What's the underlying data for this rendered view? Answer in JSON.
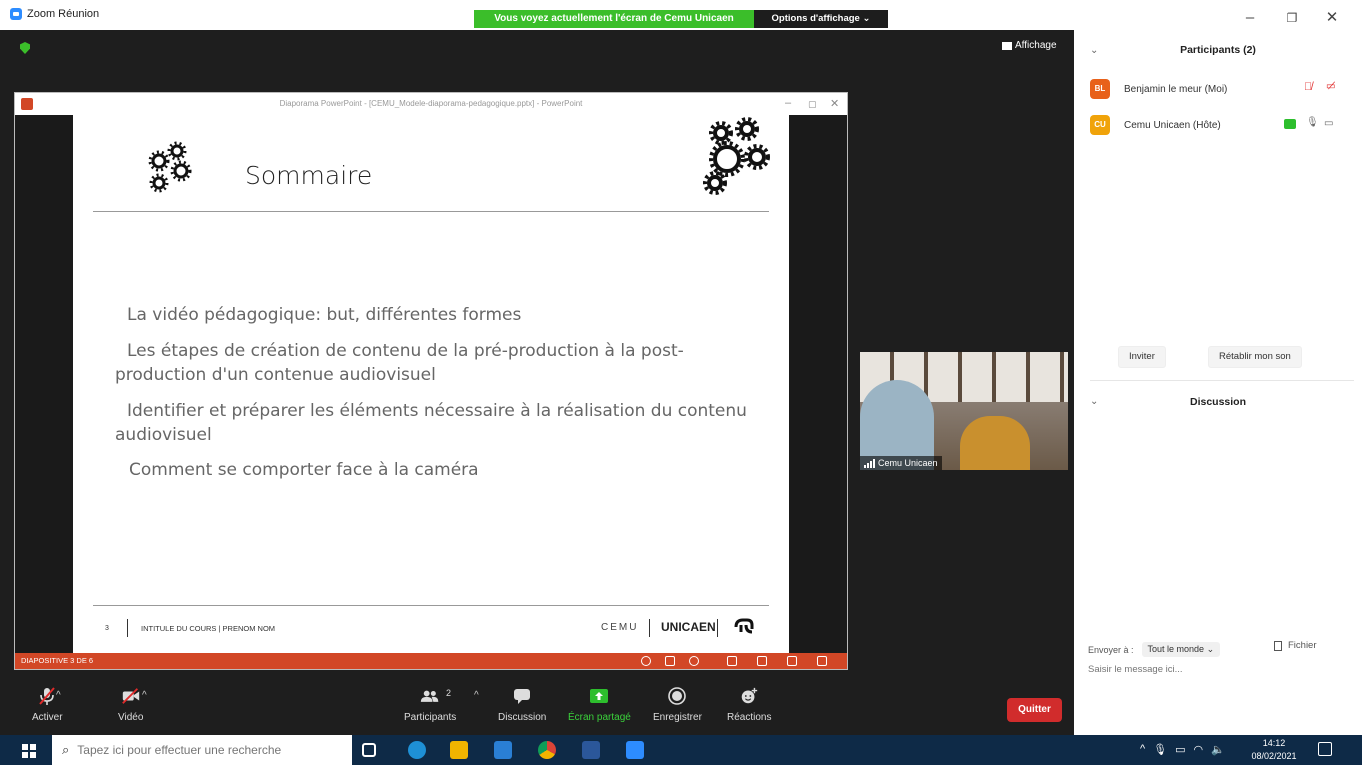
{
  "window": {
    "title": "Zoom Réunion",
    "share_banner": "Vous voyez actuellement l'écran de Cemu Unicaen",
    "view_options": "Options d'affichage ⌄",
    "affichage": "Affichage"
  },
  "ppt": {
    "title": "Diaporama PowerPoint - [CEMU_Modele-diaporama-pedagogique.pptx] - PowerPoint",
    "slide_title": "Sommaire",
    "bullets": [
      "La vidéo pédagogique: but, différentes formes",
      "Les étapes de création de contenu de la pré-production à la post-production d'un contenue audiovisuel",
      "Identifier et préparer les éléments nécessaire à la réalisation du contenu audiovisuel",
      "Comment se comporter face à la caméra"
    ],
    "footer_num": "3",
    "footer_course": "INTITULE DU COURS | PRENOM NOM",
    "footer_cemu": "CEMU",
    "footer_unicaen": "UNICAEN",
    "status": "DIAPOSITIVE 3 DE 6"
  },
  "video": {
    "name": "Cemu Unicaen"
  },
  "toolbar": {
    "activer": "Activer",
    "video": "Vidéo",
    "participants": "Participants",
    "participants_count": "2",
    "discussion": "Discussion",
    "ecran_partage": "Écran partagé",
    "enregistrer": "Enregistrer",
    "reactions": "Réactions",
    "quitter": "Quitter"
  },
  "panel": {
    "participants_title": "Participants (2)",
    "participants": [
      {
        "initials": "BL",
        "name": "Benjamin le meur (Moi)",
        "color": "#e8611a"
      },
      {
        "initials": "CU",
        "name": "Cemu Unicaen (Hôte)",
        "color": "#f0a30a"
      }
    ],
    "inviter": "Inviter",
    "retablir": "Rétablir mon son",
    "discussion_title": "Discussion",
    "send_to_label": "Envoyer à :",
    "send_to_value": "Tout le monde ⌄",
    "fichier": "Fichier",
    "message_placeholder": "Saisir le message ici..."
  },
  "taskbar": {
    "search_placeholder": "Tapez ici pour effectuer une recherche",
    "time": "14:12",
    "date": "08/02/2021"
  }
}
